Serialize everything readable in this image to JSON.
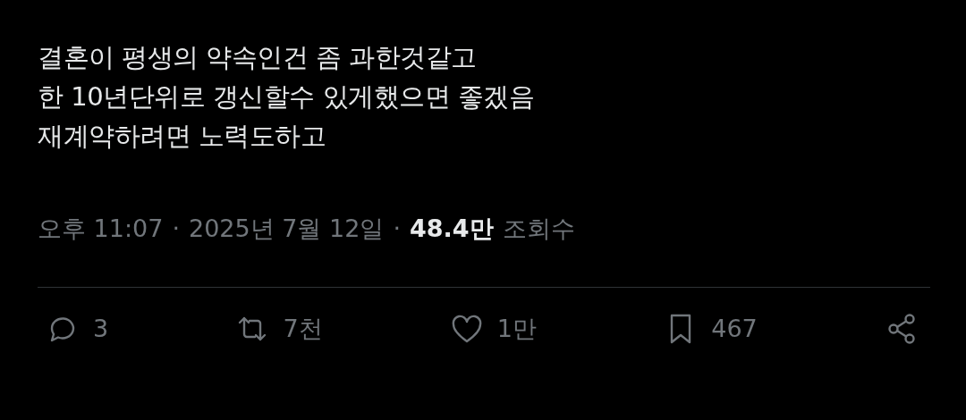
{
  "tweet": {
    "text": "결혼이 평생의 약속인건 좀 과한것같고\n한 10년단위로 갱신할수 있게했으면 좋겠음\n재계약하려면 노력도하고"
  },
  "meta": [
    {
      "kind": "text",
      "text": "오후 11:07"
    },
    {
      "kind": "separator",
      "text": "·"
    },
    {
      "kind": "text",
      "text": "2025년 7월 12일"
    },
    {
      "kind": "separator",
      "text": "·"
    },
    {
      "kind": "strong",
      "text": "48.4만"
    },
    {
      "kind": "text",
      "text": "조회수"
    }
  ],
  "actions": [
    {
      "kind": "reply",
      "count": "3"
    },
    {
      "kind": "retweet",
      "count": "7천"
    },
    {
      "kind": "like",
      "count": "1만"
    },
    {
      "kind": "bookmark",
      "count": "467"
    },
    {
      "kind": "share"
    }
  ]
}
